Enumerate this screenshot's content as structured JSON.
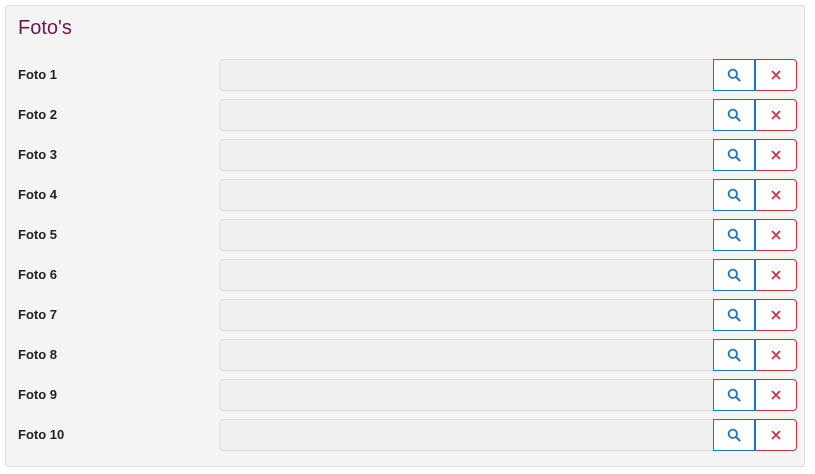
{
  "panel": {
    "title": "Foto's"
  },
  "colors": {
    "title": "#6a1b4d",
    "browse_accent": "#1e76c4",
    "clear_accent": "#d12d46",
    "panel_background": "#f4f4f5",
    "field_background": "#eeeff0"
  },
  "photos": [
    {
      "label": "Foto 1",
      "value": ""
    },
    {
      "label": "Foto 2",
      "value": ""
    },
    {
      "label": "Foto 3",
      "value": ""
    },
    {
      "label": "Foto 4",
      "value": ""
    },
    {
      "label": "Foto 5",
      "value": ""
    },
    {
      "label": "Foto 6",
      "value": ""
    },
    {
      "label": "Foto 7",
      "value": ""
    },
    {
      "label": "Foto 8",
      "value": ""
    },
    {
      "label": "Foto 9",
      "value": ""
    },
    {
      "label": "Foto 10",
      "value": ""
    }
  ],
  "icons": {
    "browse": "search-icon",
    "clear": "close-icon"
  }
}
